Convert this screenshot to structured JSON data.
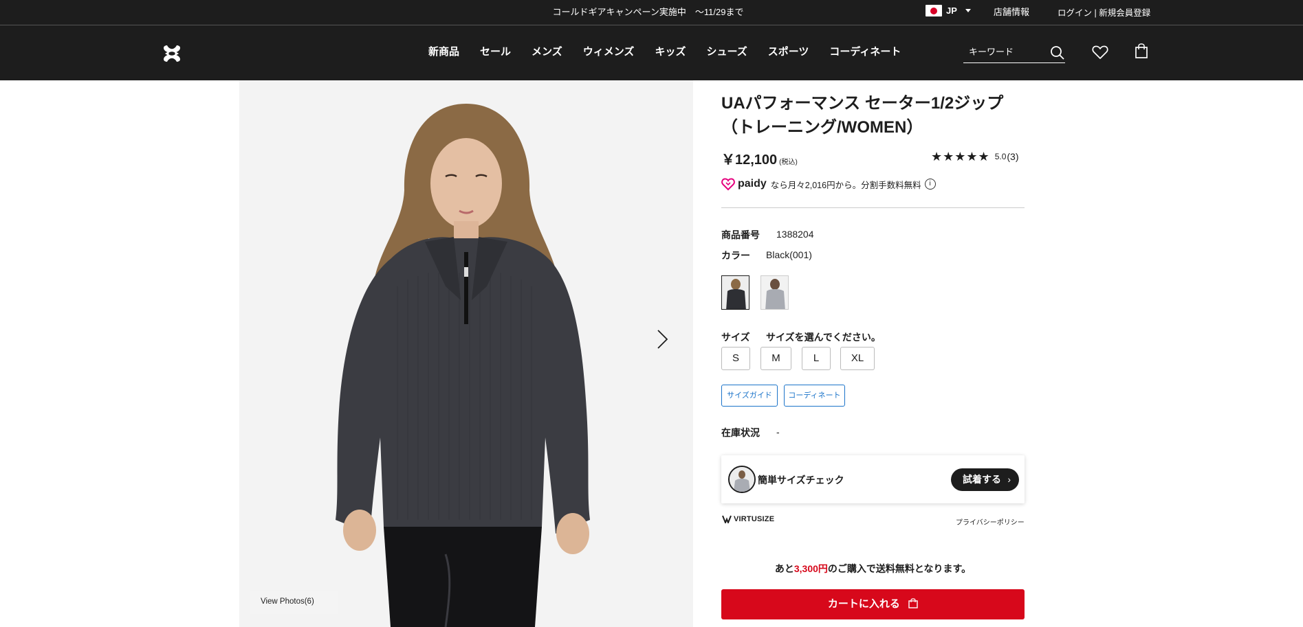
{
  "topbar": {
    "promo": "コールドギアキャンペーン実施中　～11/29まで",
    "country": "JP",
    "stores": "店舗情報",
    "login": "ログイン | 新規会員登録"
  },
  "nav": {
    "items": [
      "新商品",
      "セール",
      "メンズ",
      "ウィメンズ",
      "キッズ",
      "シューズ",
      "スポーツ",
      "コーディネート"
    ]
  },
  "search": {
    "placeholder": "キーワード"
  },
  "product": {
    "title_line1": "UAパフォーマンス セーター1/2ジップ",
    "title_line2": "（トレーニング/WOMEN）",
    "price": "￥12,100",
    "tax_note": "(税込)",
    "rating_score": "5.0",
    "rating_count": "(3)",
    "stars": "★★★★★",
    "paidy_brand": "paidy",
    "paidy_text": "なら月々2,016円から。分割手数料無料",
    "product_number_label": "商品番号",
    "product_number": "1388204",
    "color_label": "カラー",
    "color_value": "Black(001)",
    "size_label": "サイズ",
    "size_prompt": "サイズを選んでください。",
    "sizes": [
      "S",
      "M",
      "L",
      "XL"
    ],
    "size_guide": "サイズガイド",
    "coordinate": "コーディネート",
    "stock_label": "在庫状況",
    "stock_value": "-"
  },
  "gallery": {
    "view_photos": "View Photos(6)"
  },
  "virtusize": {
    "check_label": "簡単サイズチェック",
    "try_button": "試着する",
    "brand": "VIRTUSIZE",
    "privacy": "プライバシーポリシー"
  },
  "shipping": {
    "prefix": "あと",
    "amount": "3,300円",
    "suffix": "のご購入で送料無料となります。"
  },
  "cart": {
    "label": "カートに入れる"
  },
  "colors": {
    "header_bg": "#1d1d1d",
    "cart_red": "#d7081b",
    "link_blue": "#1a73c9",
    "paidy_pink": "#e5007d"
  }
}
